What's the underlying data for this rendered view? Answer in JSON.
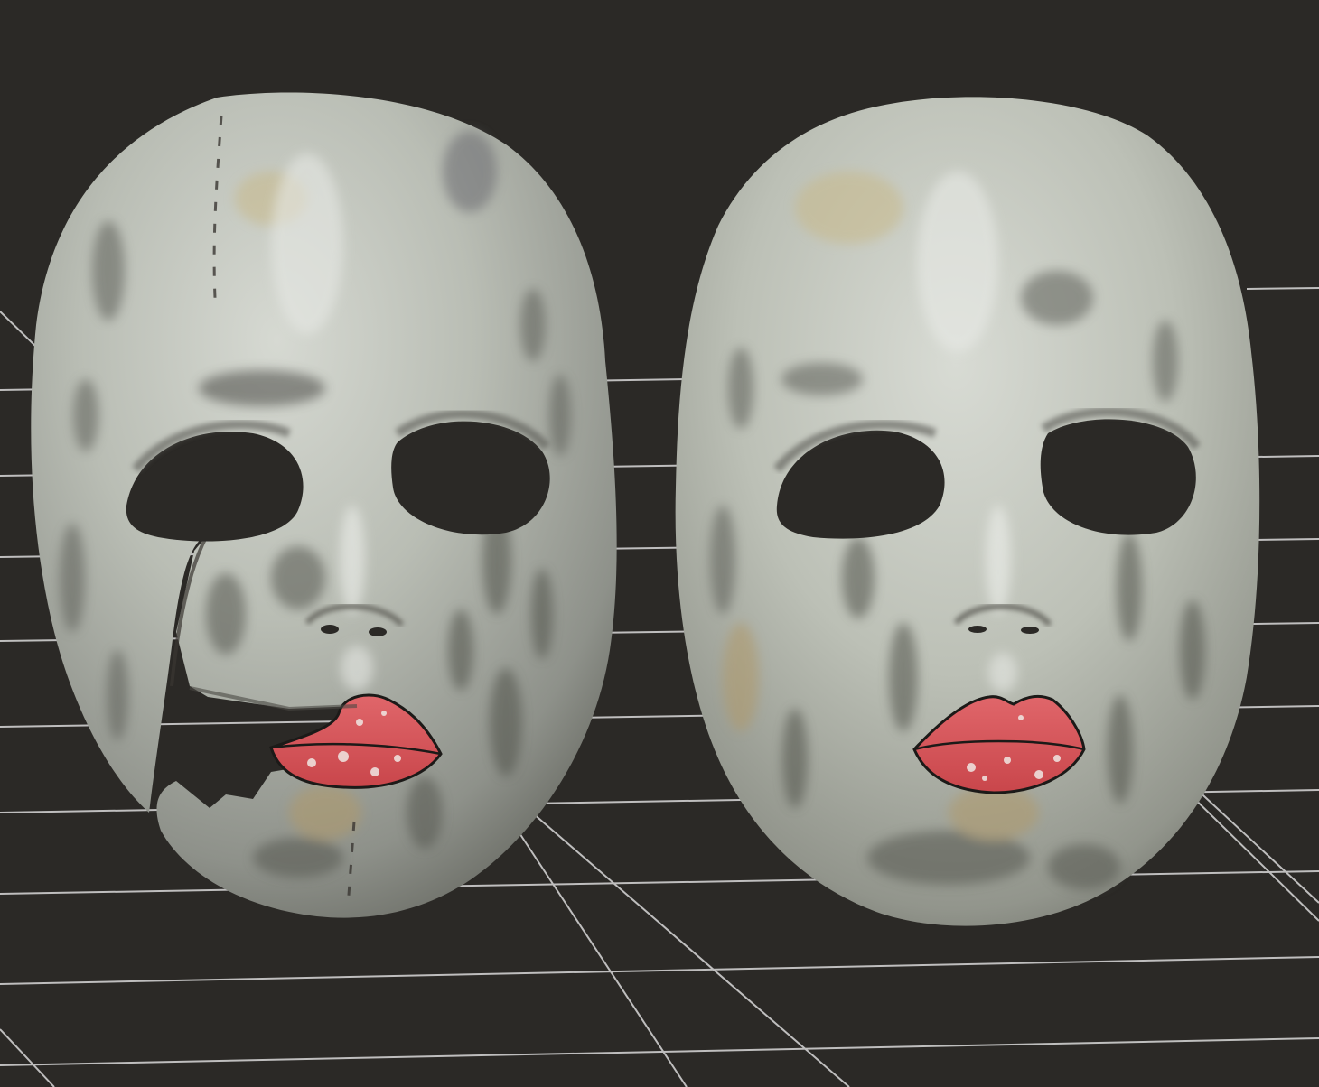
{
  "scene": {
    "background_color": "#2b2926",
    "grid_color": "#d9d9d9",
    "mask_base_color": "#b9bdb4",
    "mask_shadow_color": "#6f716a",
    "lip_color": "#d9555a",
    "eye_hole_color": "#2b2926",
    "objects": [
      "damaged-face-mask",
      "intact-face-mask"
    ],
    "grid": "on"
  }
}
